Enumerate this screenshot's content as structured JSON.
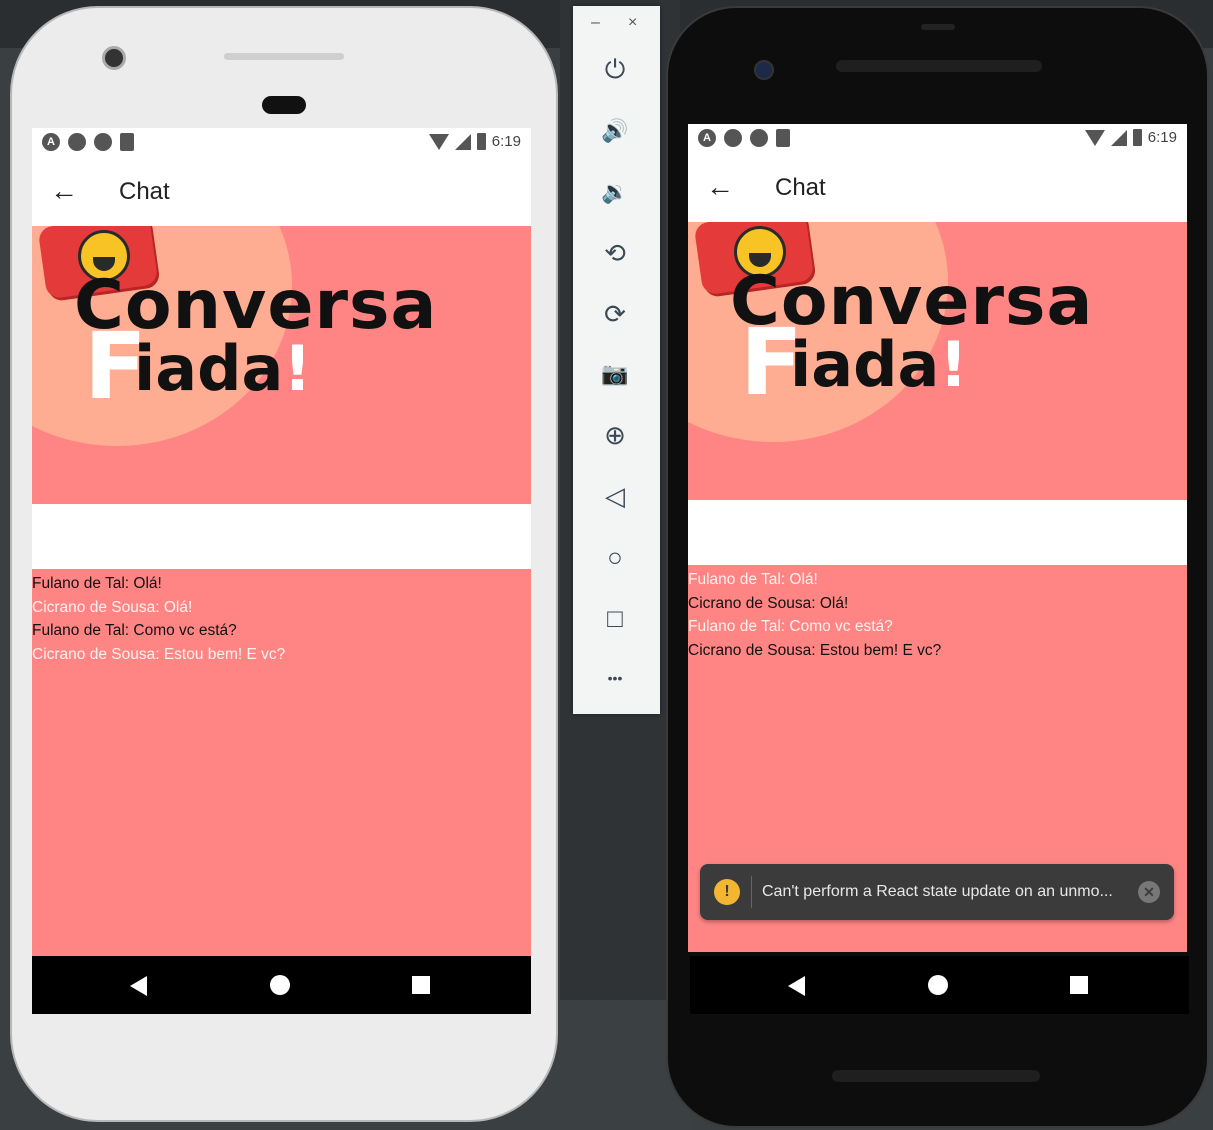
{
  "phones": [
    {
      "status": {
        "time": "6:19"
      },
      "appbar": {
        "title": "Chat"
      },
      "logo": {
        "line1": "Conversa",
        "f_letter": "F",
        "line2": "iada",
        "bang": "!"
      },
      "input": {
        "value": "",
        "placeholder": ""
      },
      "messages": [
        {
          "text": "Fulano de Tal: Olá!",
          "tone": "dark"
        },
        {
          "text": "Cicrano de Sousa: Olá!",
          "tone": "light"
        },
        {
          "text": "Fulano de Tal: Como vc está?",
          "tone": "dark"
        },
        {
          "text": "Cicrano de Sousa: Estou bem! E vc?",
          "tone": "light"
        }
      ]
    },
    {
      "status": {
        "time": "6:19"
      },
      "appbar": {
        "title": "Chat"
      },
      "logo": {
        "line1": "Conversa",
        "f_letter": "F",
        "line2": "iada",
        "bang": "!"
      },
      "input": {
        "value": "",
        "placeholder": ""
      },
      "messages": [
        {
          "text": "Fulano de Tal: Olá!",
          "tone": "light"
        },
        {
          "text": "Cicrano de Sousa: Olá!",
          "tone": "dark"
        },
        {
          "text": "Fulano de Tal: Como vc está?",
          "tone": "light"
        },
        {
          "text": "Cicrano de Sousa: Estou bem! E vc?",
          "tone": "dark"
        }
      ],
      "toast": {
        "text": "Can't perform a React state update on an unmo...",
        "warn_glyph": "!",
        "close_glyph": "✕"
      }
    }
  ],
  "toolbar": {
    "minimize": "–",
    "close": "×",
    "buttons": [
      {
        "name": "power-icon",
        "glyph": "⏻"
      },
      {
        "name": "volume-up-icon",
        "glyph": "🔊"
      },
      {
        "name": "volume-down-icon",
        "glyph": "🔉"
      },
      {
        "name": "rotate-left-icon",
        "glyph": "⟲"
      },
      {
        "name": "rotate-right-icon",
        "glyph": "⟳"
      },
      {
        "name": "camera-icon",
        "glyph": "📷"
      },
      {
        "name": "zoom-icon",
        "glyph": "⊕"
      },
      {
        "name": "back-icon",
        "glyph": "◁"
      },
      {
        "name": "home-icon",
        "glyph": "○"
      },
      {
        "name": "overview-icon",
        "glyph": "□"
      },
      {
        "name": "more-icon",
        "glyph": "•••"
      }
    ]
  },
  "colors": {
    "screen_bg": "#ff8585",
    "banner_circle": "#ffad92",
    "toast_bg": "#3b3b3b",
    "warn": "#f2b632"
  }
}
